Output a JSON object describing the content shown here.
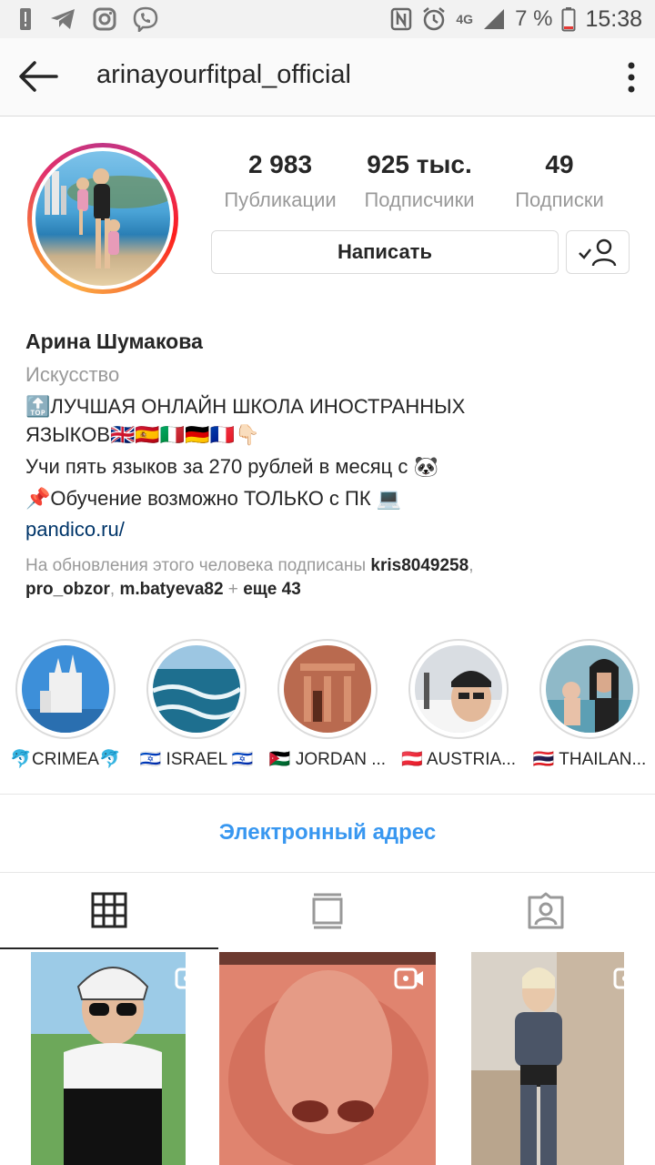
{
  "status_bar": {
    "network": "4G",
    "battery": "7 %",
    "time": "15:38"
  },
  "header": {
    "username": "arinayourfitpal_official"
  },
  "stats": [
    {
      "value": "2 983",
      "label": "Публикации"
    },
    {
      "value": "925 тыс.",
      "label": "Подписчики"
    },
    {
      "value": "49",
      "label": "Подписки"
    }
  ],
  "actions": {
    "message_label": "Написать"
  },
  "bio": {
    "name": "Арина Шумакова",
    "category": "Искусство",
    "line1": "🔝ЛУЧШАЯ ОНЛАЙН ШКОЛА ИНОСТРАННЫХ",
    "line2": "ЯЗЫКОВ🇬🇧🇪🇸🇮🇹🇩🇪🇫🇷👇🏻",
    "line3": "Учи пять языков за 270 рублей в месяц с 🐼",
    "line4": "📌Обучение возможно ТОЛЬКО с ПК 💻",
    "link": "pandico.ru/",
    "followed_prefix": "На обновления этого человека подписаны ",
    "followed_user1": "kris8049258",
    "followed_sep1": ",",
    "followed_user2": "pro_obzor",
    "followed_sep2": ", ",
    "followed_user3": "m.batyeva82",
    "followed_sep3": " + ",
    "followed_more": "еще 43"
  },
  "highlights": [
    {
      "label": "🐬CRIMEA🐬"
    },
    {
      "label": "🇮🇱 ISRAEL 🇮🇱"
    },
    {
      "label": "🇯🇴 JORDAN ..."
    },
    {
      "label": "🇦🇹 AUSTRIA..."
    },
    {
      "label": "🇹🇭 THAILAN..."
    }
  ],
  "contact": {
    "email_label": "Электронный адрес"
  },
  "colors": {
    "accent_blue": "#3897f0",
    "link_blue": "#003569",
    "text": "#262626",
    "muted": "#999999",
    "border": "#dbdbdb"
  },
  "icons": [
    "back-arrow-icon",
    "more-vertical-icon",
    "followed-check-icon",
    "grid-icon",
    "feed-icon",
    "tagged-icon",
    "video-icon"
  ]
}
